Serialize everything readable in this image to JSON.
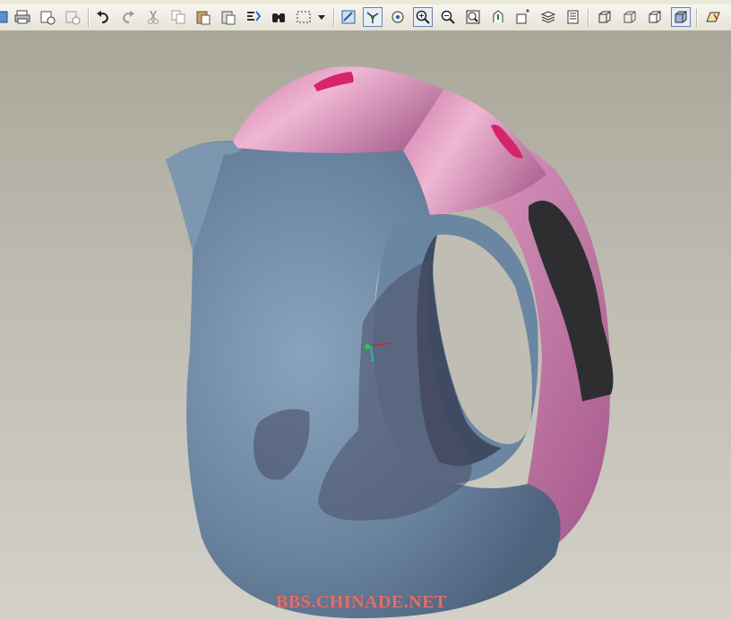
{
  "toolbar": {
    "icons": [
      "layer-tree-icon",
      "print-icon",
      "mail-icon",
      "mail-attach-icon",
      "undo-icon",
      "redo-icon",
      "cut-icon",
      "copy-icon",
      "paste-icon",
      "paste-special-icon",
      "regenerate-icon",
      "find-icon",
      "select-box-icon",
      "dropdown-arrow-icon",
      "repaint-icon",
      "spin-center-icon",
      "orient-mode-icon",
      "zoom-in-icon",
      "zoom-out-icon",
      "refit-icon",
      "reorient-icon",
      "saved-views-icon",
      "layers-icon",
      "model-tree-icon",
      "wireframe-icon",
      "hidden-line-icon",
      "no-hidden-icon",
      "shading-icon",
      "datum-plane-icon"
    ],
    "active": [
      "spin-center-icon",
      "zoom-in-icon",
      "shading-icon"
    ]
  },
  "viewport": {
    "model_colors": {
      "body": "#6f8aa5",
      "lid": "#d88bb4",
      "button": "#d6246a",
      "grip": "#2e2e30",
      "shadow": "#4a4f66"
    }
  },
  "watermark": "BBS.CHINADE.NET"
}
